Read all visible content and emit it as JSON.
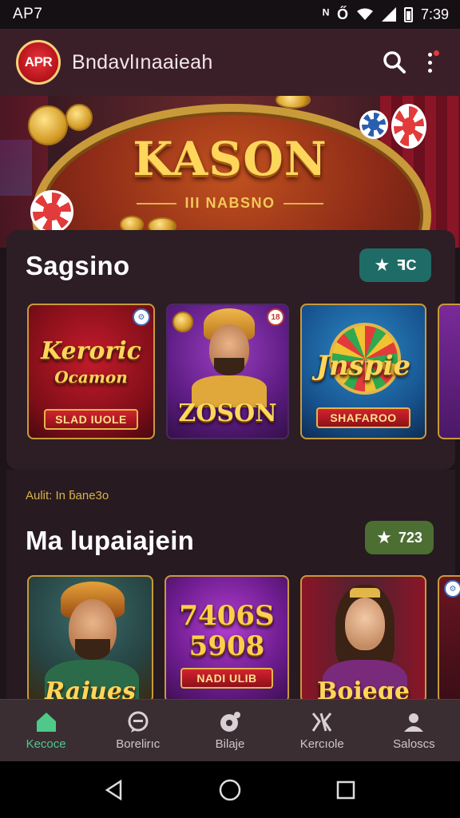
{
  "status_bar": {
    "carrier": "AP7",
    "network_glyph": "ᴺ",
    "alarm_glyph": "Ő",
    "time": "7:39"
  },
  "app_bar": {
    "logo_text": "APR",
    "title": "Bndavlınaaieah"
  },
  "hero": {
    "title": "KASON",
    "subtitle": "III NABSNO"
  },
  "section1": {
    "title": "Sagsino",
    "pill_text": "ꟻC",
    "games": [
      {
        "title": "Keroric",
        "subtitle": "Ocamon",
        "banner": "SLAD IUOLE"
      },
      {
        "title": "ZOSON",
        "badge": "18"
      },
      {
        "title": "Jnspie",
        "banner": "SHAFAROO"
      },
      {
        "title": ""
      }
    ]
  },
  "section2": {
    "subheading": "Aulit: In ƃane3o",
    "title": "Ma lupaiajein",
    "pill_text": "723",
    "games": [
      {
        "title": "Rajues"
      },
      {
        "title": "7406S 5908",
        "banner": "NADI ULIB"
      },
      {
        "title": "Boiege"
      },
      {
        "title": ""
      }
    ]
  },
  "bottom_nav": [
    {
      "label": "Kecoce",
      "icon": "home-icon",
      "active": true
    },
    {
      "label": "Borelirıc",
      "icon": "chat-icon",
      "active": false
    },
    {
      "label": "Bilaje",
      "icon": "chip-icon",
      "active": false
    },
    {
      "label": "Kercıole",
      "icon": "games-icon",
      "active": false
    },
    {
      "label": "Saloscs",
      "icon": "profile-icon",
      "active": false
    }
  ],
  "colors": {
    "accent": "#4ec98a",
    "app_bar": "#3b1f28",
    "gold": "#ffd65c",
    "pill_teal": "#1f6b66",
    "pill_green": "#4c6e33"
  }
}
